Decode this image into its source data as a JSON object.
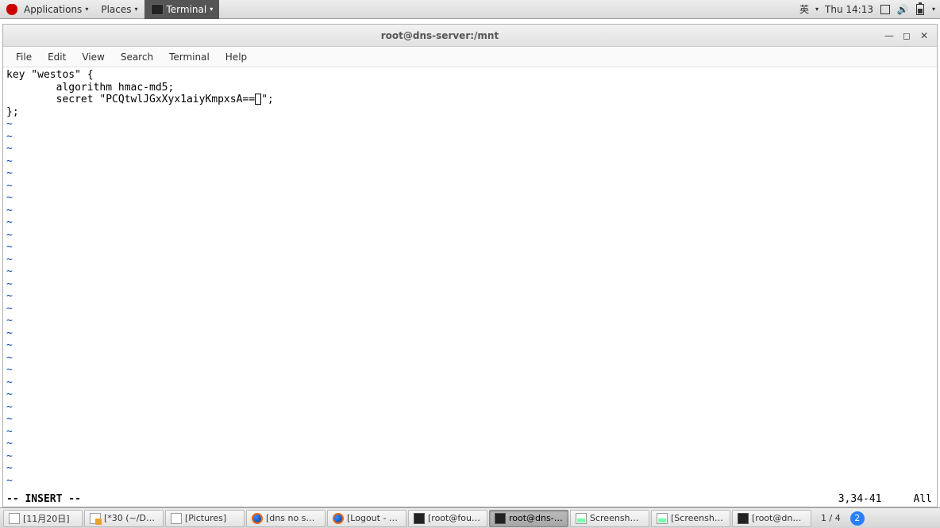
{
  "top_panel": {
    "applications": "Applications",
    "places": "Places",
    "terminal": "Terminal",
    "ime": "英",
    "clock": "Thu 14:13"
  },
  "window": {
    "title": "root@dns-server:/mnt",
    "menubar": [
      "File",
      "Edit",
      "View",
      "Search",
      "Terminal",
      "Help"
    ]
  },
  "editor": {
    "lines": [
      "key \"westos\" {",
      "        algorithm hmac-md5;",
      "        secret \"PCQtwlJGxXyx1aiyKmpxsA=="
    ],
    "line3_tail": "\";",
    "line4": "};",
    "mode": "-- INSERT --",
    "position": "3,34-41",
    "scroll": "All"
  },
  "taskbar": {
    "items": [
      {
        "icon": "doc",
        "label": "[11月20日]"
      },
      {
        "icon": "edit",
        "label": "[*30 (~/Des…"
      },
      {
        "icon": "doc",
        "label": "[Pictures]"
      },
      {
        "icon": "ff",
        "label": "[dns no ser…"
      },
      {
        "icon": "ff",
        "label": "[Logout - …"
      },
      {
        "icon": "term",
        "label": "[root@foun…"
      },
      {
        "icon": "term",
        "label": "root@dns-…",
        "active": true
      },
      {
        "icon": "img",
        "label": "Screenshot …"
      },
      {
        "icon": "img",
        "label": "[Screenshot…"
      },
      {
        "icon": "term",
        "label": "[root@dns-…"
      }
    ],
    "workspace": "1 / 4",
    "badge": "2"
  }
}
